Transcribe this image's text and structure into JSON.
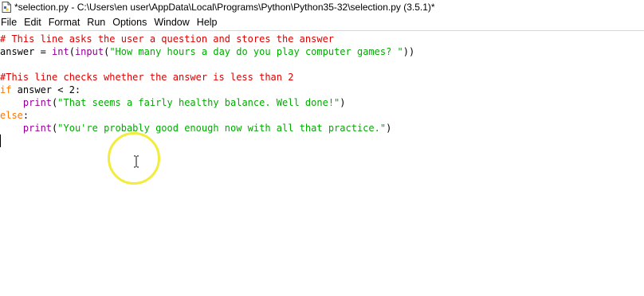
{
  "window": {
    "title": "*selection.py - C:\\Users\\en user\\AppData\\Local\\Programs\\Python\\Python35-32\\selection.py (3.5.1)*",
    "icon": "python-file-icon"
  },
  "menubar": {
    "items": [
      "File",
      "Edit",
      "Format",
      "Run",
      "Options",
      "Window",
      "Help"
    ]
  },
  "editor": {
    "language": "python",
    "lines": [
      [
        {
          "t": "# This line asks the user a question and stores the answer",
          "c": "comment"
        }
      ],
      [
        {
          "t": "answer = ",
          "c": "plain"
        },
        {
          "t": "int",
          "c": "builtin"
        },
        {
          "t": "(",
          "c": "plain"
        },
        {
          "t": "input",
          "c": "builtin"
        },
        {
          "t": "(",
          "c": "plain"
        },
        {
          "t": "\"How many hours a day do you play computer games? \"",
          "c": "string"
        },
        {
          "t": "))",
          "c": "plain"
        }
      ],
      [],
      [
        {
          "t": "#This line checks whether the answer is less than 2",
          "c": "comment"
        }
      ],
      [
        {
          "t": "if",
          "c": "keyword"
        },
        {
          "t": " answer < 2:",
          "c": "plain"
        }
      ],
      [
        {
          "t": "    ",
          "c": "plain"
        },
        {
          "t": "print",
          "c": "builtin"
        },
        {
          "t": "(",
          "c": "plain"
        },
        {
          "t": "\"That seems a fairly healthy balance. Well done!\"",
          "c": "string"
        },
        {
          "t": ")",
          "c": "plain"
        }
      ],
      [
        {
          "t": "else",
          "c": "keyword"
        },
        {
          "t": ":",
          "c": "plain"
        }
      ],
      [
        {
          "t": "    ",
          "c": "plain"
        },
        {
          "t": "print",
          "c": "builtin"
        },
        {
          "t": "(",
          "c": "plain"
        },
        {
          "t": "\"You're probably good enough now with all that practice.\"",
          "c": "string"
        },
        {
          "t": ")",
          "c": "plain"
        }
      ],
      []
    ]
  },
  "colors": {
    "comment": "#dd0000",
    "keyword": "#ff7700",
    "builtin": "#900090",
    "string": "#00aa00",
    "cursor_highlight": "#f2ec3a"
  }
}
